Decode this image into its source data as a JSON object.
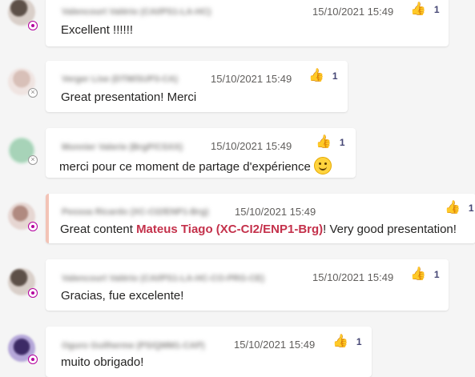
{
  "messages": [
    {
      "sender": "Valencourt Valério (CAI/PS1-LA-HC)",
      "time": "15/10/2021 15:49",
      "reaction": {
        "icon": "thumbs-up-icon",
        "glyph": "👍",
        "count": "1"
      },
      "text": "Excellent !!!!!!",
      "presence": "away"
    },
    {
      "sender": "Verger Lise (DTM/SUP3-CA)",
      "time": "15/10/2021 15:49",
      "reaction": {
        "icon": "thumbs-up-icon",
        "glyph": "👍",
        "count": "1"
      },
      "text": "Great presentation! Merci",
      "presence": "offline"
    },
    {
      "sender": "Monnier Valerie (BrgP/CSXX)",
      "time": "15/10/2021 15:49",
      "reaction": {
        "icon": "thumbs-up-icon",
        "glyph": "👍",
        "count": "1"
      },
      "text": "merci pour ce moment de partage d'expérience",
      "emoji": "smiley-icon",
      "presence": "offline"
    },
    {
      "sender": "Pessoa Ricardo (XC-CI2/ENP1-Brg)",
      "time": "15/10/2021 15:49",
      "reaction": {
        "icon": "thumbs-up-icon",
        "glyph": "👍",
        "count": "1"
      },
      "text_before": "Great content ",
      "mention": "Mateus Tiago (XC-CI2/ENP1-Brg)",
      "text_after": "! Very good presentation!",
      "presence": "away"
    },
    {
      "sender": "Valencourt Valério (CAI/PS1-LA-HC-CO-PRG-CE)",
      "time": "15/10/2021 15:49",
      "reaction": {
        "icon": "thumbs-up-icon",
        "glyph": "👍",
        "count": "1"
      },
      "text": "Gracias, fue excelente!",
      "presence": "away"
    },
    {
      "sender": "Oguro Guilherme (PS/QMM1-CAP)",
      "time": "15/10/2021 15:49",
      "reaction": {
        "icon": "thumbs-up-icon",
        "glyph": "👍",
        "count": "1"
      },
      "text": "muito obrigado!",
      "presence": "away"
    }
  ],
  "colors": {
    "background": "#f5f5f5",
    "card": "#ffffff",
    "mention": "#c4314b",
    "reaction_count": "#464775",
    "presence_away": "#b4009e",
    "mention_bar": "#f3c3b6"
  }
}
